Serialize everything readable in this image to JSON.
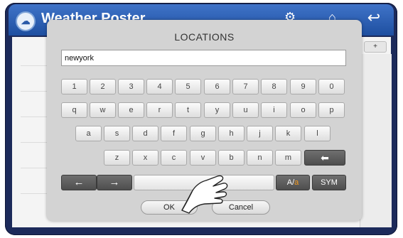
{
  "app": {
    "title": "Weather Poster",
    "icon": "weather-app-icon",
    "topbar_icons": [
      "settings-icon",
      "home-icon",
      "back-icon"
    ]
  },
  "content": {
    "add_label": "+"
  },
  "dialog": {
    "title": "LOCATIONS",
    "input_value": "newyork",
    "ok_label": "OK",
    "cancel_label": "Cancel"
  },
  "keyboard": {
    "row1": [
      "1",
      "2",
      "3",
      "4",
      "5",
      "6",
      "7",
      "8",
      "9",
      "0"
    ],
    "row2": [
      "q",
      "w",
      "e",
      "r",
      "t",
      "y",
      "u",
      "i",
      "o",
      "p"
    ],
    "row3": [
      "a",
      "s",
      "d",
      "f",
      "g",
      "h",
      "j",
      "k",
      "l"
    ],
    "row4": [
      "z",
      "x",
      "c",
      "v",
      "b",
      "n",
      "m"
    ],
    "left_arrow": "←",
    "right_arrow": "→",
    "backspace": "⬅",
    "case_prefix": "A/",
    "case_suffix": "a",
    "sym_label": "SYM"
  },
  "colors": {
    "topbar": "#2f63b8",
    "accent_orange": "#f29a22",
    "dark_key": "#5a5a5a"
  }
}
